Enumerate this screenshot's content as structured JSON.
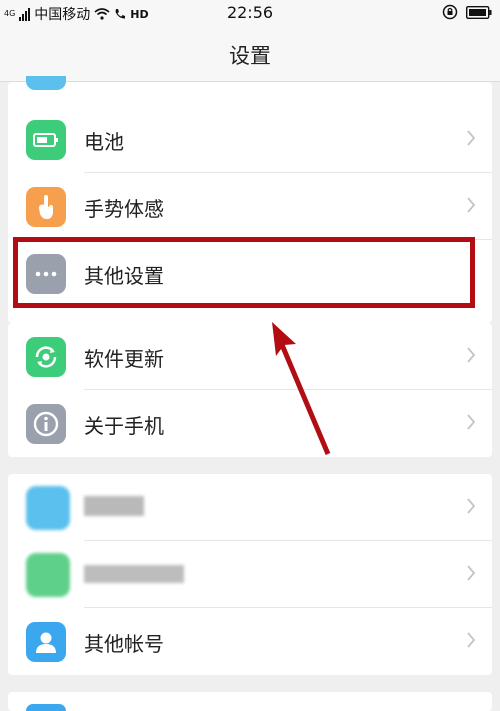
{
  "status_bar": {
    "signal_tag": "4G",
    "carrier": "中国移动",
    "call_badge": "HD",
    "time": "22:56"
  },
  "header": {
    "title": "设置"
  },
  "settings": {
    "group1": [
      {
        "label": "电池",
        "icon": "battery-icon",
        "color": "#3dcc7a"
      },
      {
        "label": "手势体感",
        "icon": "gesture-hand-icon",
        "color": "#f6a04e"
      },
      {
        "label": "其他设置",
        "icon": "more-dots-icon",
        "color": "#9aa1ad"
      }
    ],
    "group2": [
      {
        "label": "软件更新",
        "icon": "update-icon",
        "color": "#3dcc7a"
      },
      {
        "label": "关于手机",
        "icon": "info-icon",
        "color": "#9aa1ad"
      }
    ],
    "group3": [
      {
        "label": "",
        "icon": "blurred-app-icon",
        "color": "#5bc0ee"
      },
      {
        "label": "",
        "icon": "blurred-app-icon",
        "color": "#5fd08a"
      },
      {
        "label": "其他帐号",
        "icon": "account-icon",
        "color": "#3aa7ef"
      }
    ]
  },
  "annotation": {
    "highlight_color": "#b30d14"
  }
}
